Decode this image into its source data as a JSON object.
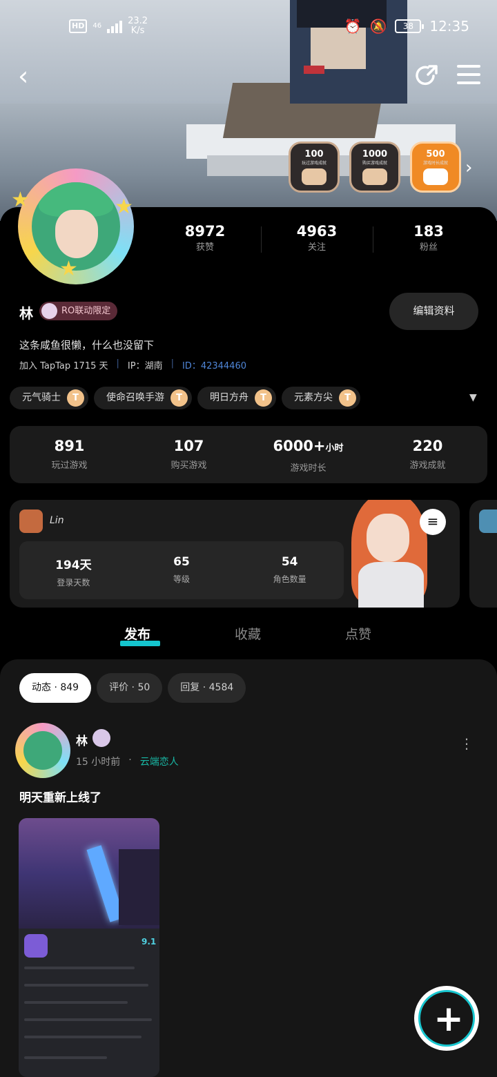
{
  "status_bar": {
    "hd": "HD",
    "network": "46",
    "speed_value": "23.2",
    "speed_unit": "K/s",
    "battery": "38",
    "time": "12:35"
  },
  "nav": {
    "back_icon": "chevron-left-icon",
    "share_icon": "share-icon",
    "menu_icon": "menu-icon"
  },
  "badges": [
    {
      "number": "100",
      "subtitle": "玩过游戏成就"
    },
    {
      "number": "1000",
      "subtitle": "购买游戏成就"
    },
    {
      "number": "500",
      "subtitle": "游戏时长成就"
    }
  ],
  "stats_top": [
    {
      "value": "8972",
      "label": "获赞"
    },
    {
      "value": "4963",
      "label": "关注"
    },
    {
      "value": "183",
      "label": "粉丝"
    }
  ],
  "profile": {
    "name": "林",
    "title_badge": "RO联动限定",
    "edit_button": "编辑资料",
    "bio": "这条咸鱼很懒，什么也没留下",
    "joined": "加入 TapTap 1715 天",
    "ip": "IP：湖南",
    "sep": "|",
    "uid": "ID：42344460"
  },
  "tags": [
    {
      "name": "元气骑士",
      "coin": "T"
    },
    {
      "name": "使命召唤手游",
      "coin": "T"
    },
    {
      "name": "明日方舟",
      "coin": "T"
    },
    {
      "name": "元素方尖",
      "coin": "T"
    }
  ],
  "tags_more": "▼",
  "game_stats": [
    {
      "value": "891",
      "unit": "",
      "label": "玩过游戏"
    },
    {
      "value": "107",
      "unit": "",
      "label": "购买游戏"
    },
    {
      "value": "6000+",
      "unit": "小时",
      "label": "游戏时长"
    },
    {
      "value": "220",
      "unit": "",
      "label": "游戏成就"
    }
  ],
  "game_card": {
    "player": "Lin",
    "filter_icon": "≡",
    "stats": [
      {
        "value": "194天",
        "label": "登录天数"
      },
      {
        "value": "65",
        "label": "等级"
      },
      {
        "value": "54",
        "label": "角色数量"
      }
    ]
  },
  "main_tabs": [
    {
      "label": "发布",
      "active": true
    },
    {
      "label": "收藏",
      "active": false
    },
    {
      "label": "点赞",
      "active": false
    }
  ],
  "chips": [
    {
      "label": "动态",
      "count": "849",
      "active": true
    },
    {
      "label": "评价",
      "count": "50",
      "active": false
    },
    {
      "label": "回复",
      "count": "4584",
      "active": false
    }
  ],
  "post": {
    "author": "林",
    "time": "15 小时前",
    "dot": "·",
    "game": "云端恋人",
    "text": "明天重新上线了",
    "more_icon": "⋮",
    "embedded_score": "9.1"
  },
  "fab": {
    "label": "+"
  }
}
